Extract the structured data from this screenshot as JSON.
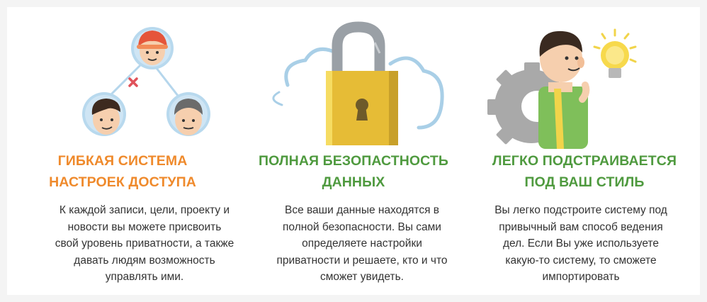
{
  "features": [
    {
      "title_line1": "ГИБКАЯ СИСТЕМА",
      "title_line2": "НАСТРОЕК ДОСТУПА",
      "desc_lines": [
        "К каждой записи, цели, проекту и",
        "новости вы можете присвоить",
        "свой уровень приватности, а также",
        "давать людям возможность",
        "управлять ими."
      ],
      "accent": "#ef8a2c",
      "icon": "access-network-people-icon"
    },
    {
      "title_line1": "ПОЛНАЯ БЕЗОПАСТНОСТЬ",
      "title_line2": "ДАННЫХ",
      "desc_lines": [
        "Все ваши данные находятся в",
        "полной безопасности. Вы сами",
        "определяете настройки",
        "приватности и решаете, кто и что",
        "сможет увидеть."
      ],
      "accent": "#4f9a3f",
      "icon": "padlock-cloud-icon"
    },
    {
      "title_line1": "ЛЕГКО ПОДСТРАИВАЕТСЯ",
      "title_line2": "ПОД ВАШ СТИЛЬ",
      "desc_lines": [
        "Вы легко подстроите систему под",
        "привычный вам способ ведения",
        "дел. Если Вы уже используете",
        "какую-то систему, то сможете",
        "импортировать"
      ],
      "accent": "#4f9a3f",
      "icon": "man-gear-lightbulb-icon"
    }
  ]
}
